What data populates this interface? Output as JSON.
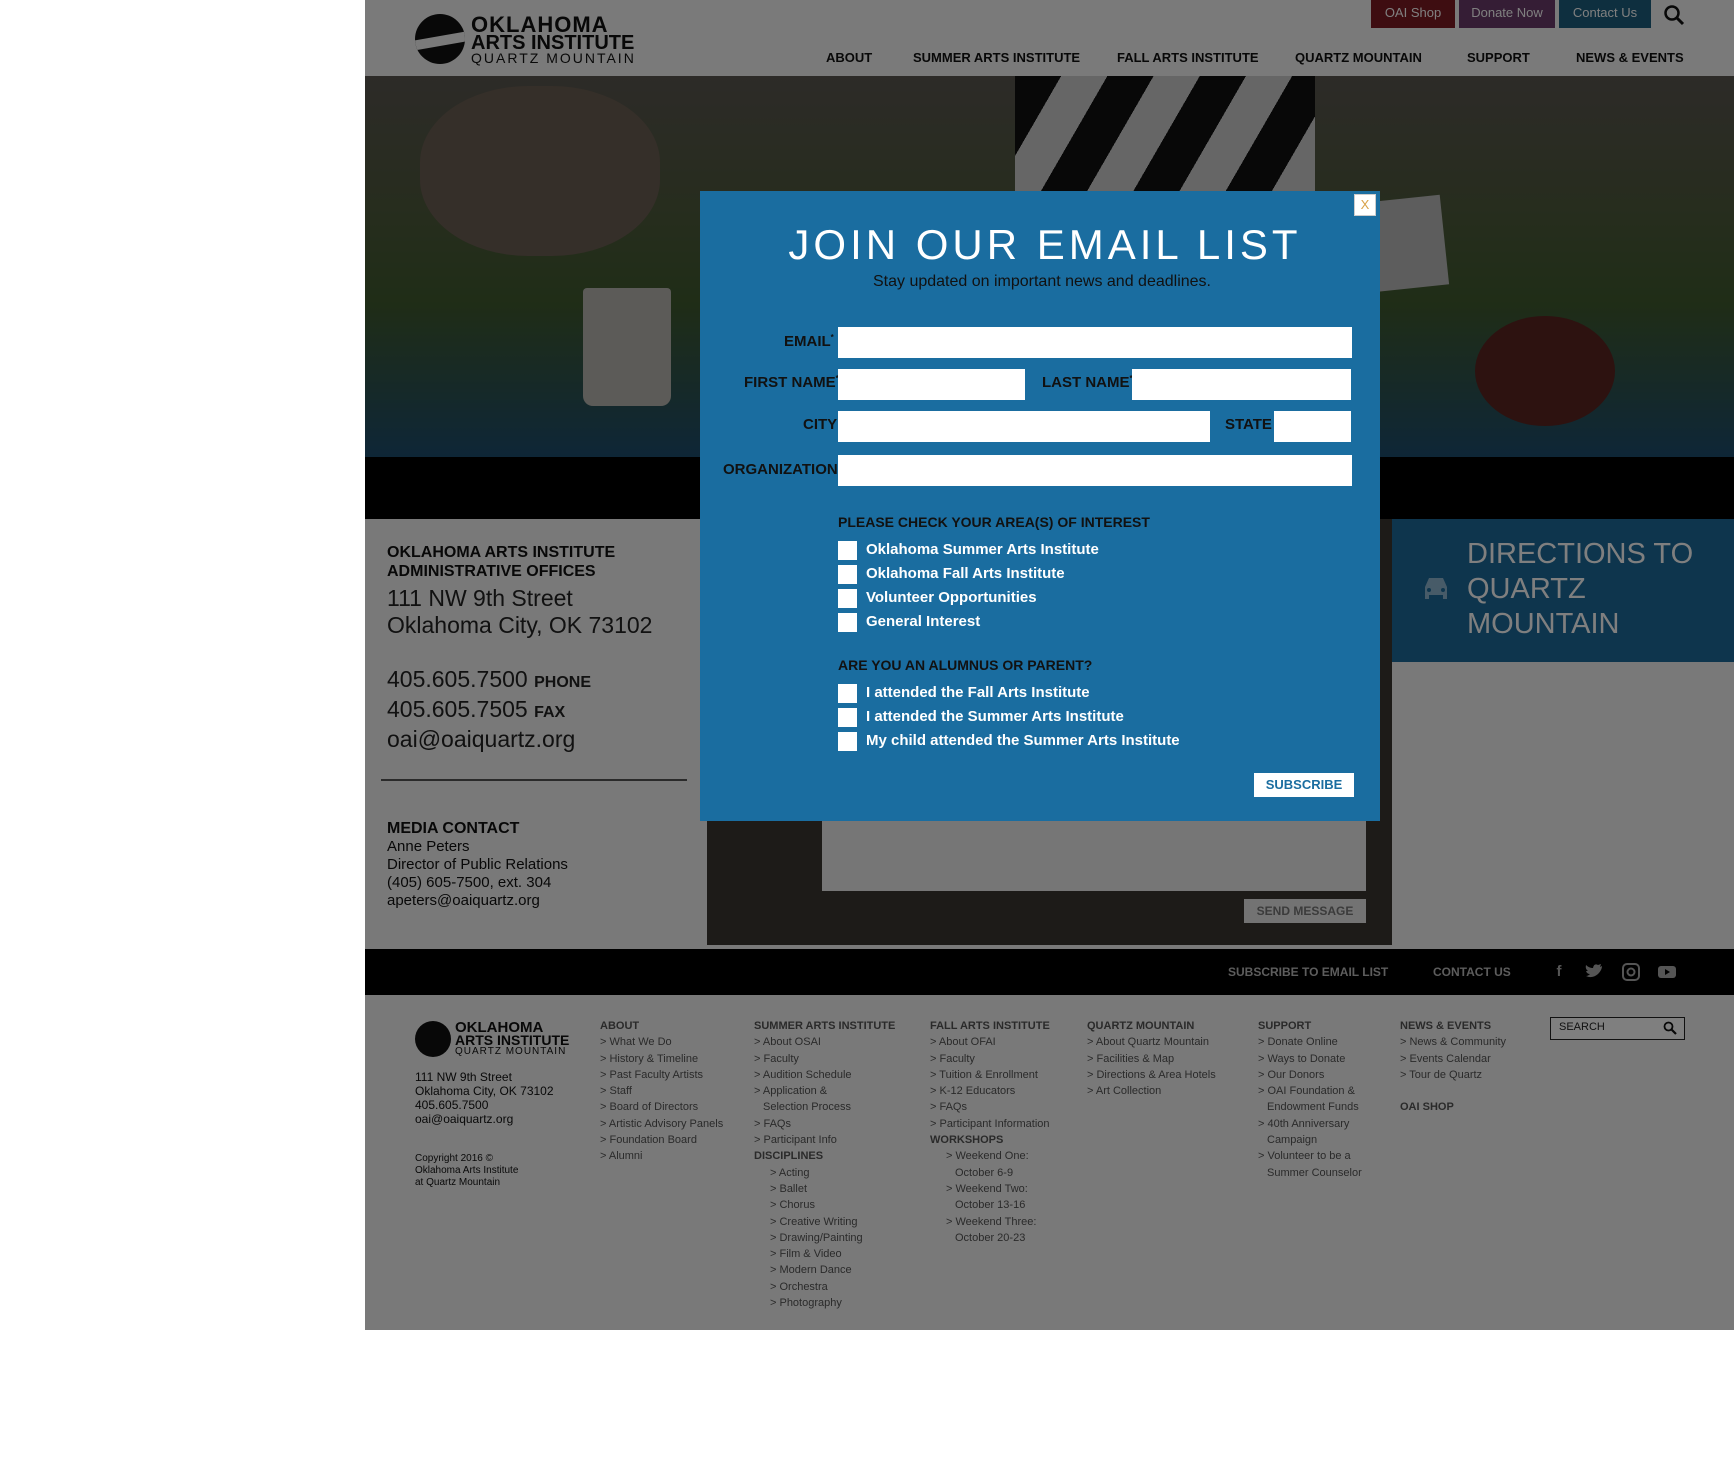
{
  "header": {
    "logo_line1": "OKLAHOMA",
    "logo_line2": "ARTS INSTITUTE",
    "logo_line3": "QUARTZ MOUNTAIN",
    "top_buttons": [
      {
        "label": "OAI Shop",
        "color": "#7d1a22"
      },
      {
        "label": "Donate Now",
        "color": "#6b3a6b"
      },
      {
        "label": "Contact Us",
        "color": "#1c5e7e"
      }
    ],
    "search_icon": "search-icon",
    "nav": [
      "ABOUT",
      "SUMMER ARTS INSTITUTE",
      "FALL ARTS INSTITUTE",
      "QUARTZ MOUNTAIN",
      "SUPPORT",
      "NEWS & EVENTS"
    ]
  },
  "contact": {
    "org_line1": "OKLAHOMA ARTS INSTITUTE",
    "org_line2": "ADMINISTRATIVE OFFICES",
    "street": "111 NW 9th Street",
    "city": "Oklahoma City, OK  73102",
    "phone": "405.605.7500",
    "phone_label": "PHONE",
    "fax": "405.605.7505",
    "fax_label": "FAX",
    "email": "oai@oaiquartz.org"
  },
  "media": {
    "heading": "MEDIA CONTACT",
    "name": "Anne Peters",
    "title": "Director of Public Relations",
    "phone": "(405) 605-7500, ext. 304",
    "email": "apeters@oaiquartz.org"
  },
  "form": {
    "send_label": "SEND MESSAGE"
  },
  "directions": {
    "label": "DIRECTIONS TO QUARTZ MOUNTAIN",
    "icon": "car-icon"
  },
  "footer_bar": {
    "subscribe": "SUBSCRIBE TO EMAIL LIST",
    "contact": "CONTACT US",
    "social": [
      "facebook-icon",
      "twitter-icon",
      "instagram-icon",
      "youtube-icon"
    ]
  },
  "footer": {
    "logo_line1": "OKLAHOMA",
    "logo_line2": "ARTS INSTITUTE",
    "logo_line3": "QUARTZ MOUNTAIN",
    "address": [
      "111 NW 9th Street",
      "Oklahoma City, OK 73102",
      "405.605.7500",
      "oai@oaiquartz.org"
    ],
    "copyright": [
      "Copyright 2016 ©",
      "Oklahoma Arts Institute",
      "at Quartz Mountain"
    ],
    "search_placeholder": "SEARCH",
    "col_about": {
      "title": "ABOUT",
      "items": [
        "> What We Do",
        "> History & Timeline",
        "> Past Faculty Artists",
        "> Staff",
        "> Board of Directors",
        "> Artistic Advisory Panels",
        "> Foundation Board",
        "> Alumni"
      ]
    },
    "col_summer": {
      "title": "SUMMER ARTS INSTITUTE",
      "items": [
        "> About OSAI",
        "> Faculty",
        "> Audition Schedule",
        "> Application &",
        "Selection Process",
        "> FAQs",
        "> Participant Info"
      ],
      "sub_title": "DISCIPLINES",
      "sub_items": [
        "> Acting",
        "> Ballet",
        "> Chorus",
        "> Creative Writing",
        "> Drawing/Painting",
        "> Film & Video",
        "> Modern Dance",
        "> Orchestra",
        "> Photography"
      ]
    },
    "col_fall": {
      "title": "FALL ARTS INSTITUTE",
      "items": [
        "> About OFAI",
        "> Faculty",
        "> Tuition & Enrollment",
        "> K-12 Educators",
        "> FAQs",
        "> Participant Information"
      ],
      "sub_title": "WORKSHOPS",
      "sub_items": [
        "> Weekend One:",
        "October 6-9",
        "> Weekend Two:",
        "October 13-16",
        "> Weekend Three:",
        "October 20-23"
      ]
    },
    "col_quartz": {
      "title": "QUARTZ MOUNTAIN",
      "items": [
        "> About Quartz Mountain",
        "> Facilities & Map",
        "> Directions & Area Hotels",
        "> Art Collection"
      ]
    },
    "col_support": {
      "title": "SUPPORT",
      "items": [
        "> Donate Online",
        "> Ways to Donate",
        "> Our Donors",
        "> OAI Foundation &",
        "Endowment Funds",
        "> 40th Anniversary",
        "Campaign",
        "> Volunteer to be a",
        "Summer Counselor"
      ]
    },
    "col_news": {
      "title": "NEWS & EVENTS",
      "items": [
        "> News & Community",
        "> Events Calendar",
        "> Tour de Quartz"
      ],
      "shop": "OAI SHOP"
    }
  },
  "modal": {
    "close": "X",
    "title": "JOIN OUR EMAIL LIST",
    "subtitle": "Stay updated on important news and deadlines.",
    "email_label": "EMAIL",
    "first_label": "FIRST NAME",
    "last_label": "LAST NAME",
    "city_label": "CITY",
    "state_label": "STATE",
    "org_label": "ORGANIZATION",
    "required_mark": "*",
    "interest_heading": "PLEASE CHECK YOUR AREA(S) OF INTEREST",
    "interests": [
      "Oklahoma Summer Arts Institute",
      "Oklahoma Fall Arts Institute",
      "Volunteer Opportunities",
      "General Interest"
    ],
    "alumni_heading": "ARE YOU AN ALUMNUS OR PARENT?",
    "alumni": [
      "I attended the Fall Arts Institute",
      "I attended the Summer Arts Institute",
      "My child attended the Summer Arts Institute"
    ],
    "subscribe": "SUBSCRIBE",
    "color": "#1a6da0"
  }
}
